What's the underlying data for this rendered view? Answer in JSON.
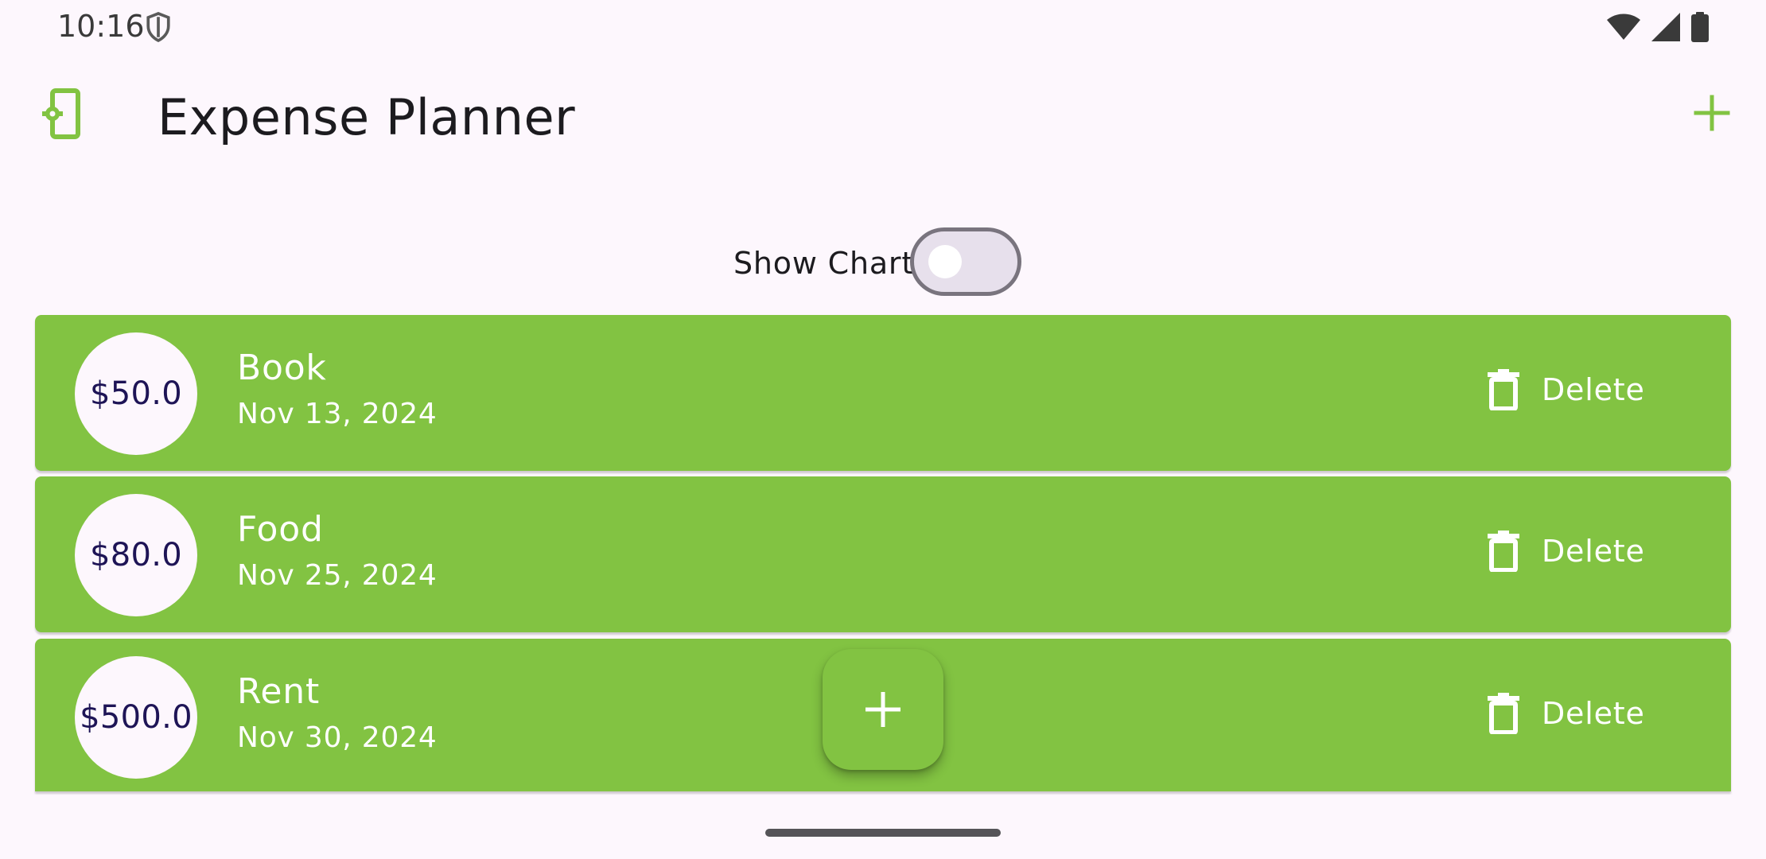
{
  "status_bar": {
    "time": "10:16",
    "icons": [
      "shield-icon",
      "wifi-icon",
      "signal-icon",
      "battery-icon"
    ]
  },
  "app_bar": {
    "title": "Expense Planner",
    "app_icon": "settings-phone-icon",
    "add_icon": "plus-icon"
  },
  "toggle": {
    "label": "Show Chart",
    "checked": false
  },
  "expenses": [
    {
      "amount": "$50.0",
      "title": "Book",
      "date": "Nov 13, 2024",
      "delete_label": "Delete"
    },
    {
      "amount": "$80.0",
      "title": "Food",
      "date": "Nov 25, 2024",
      "delete_label": "Delete"
    },
    {
      "amount": "$500.0",
      "title": "Rent",
      "date": "Nov 30, 2024",
      "delete_label": "Delete"
    }
  ],
  "fab": {
    "icon": "plus-icon"
  },
  "colors": {
    "accent": "#82c342",
    "background": "#fdf7fd",
    "amount_text": "#1e1456",
    "title_text": "#1c1b1f"
  }
}
